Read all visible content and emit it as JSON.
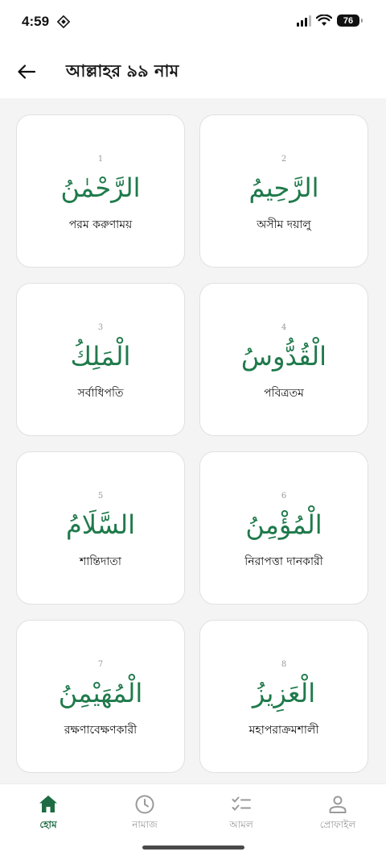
{
  "status_bar": {
    "time": "4:59",
    "battery": "76"
  },
  "header": {
    "title": "আল্লাহর ৯৯ নাম"
  },
  "names": [
    {
      "number": "1",
      "arabic": "الرَّحْمٰنُ",
      "meaning": "পরম করুণাময়"
    },
    {
      "number": "2",
      "arabic": "الرَّحِيمُ",
      "meaning": "অসীম দয়ালু"
    },
    {
      "number": "3",
      "arabic": "الْمَلِكُ",
      "meaning": "সর্বাধিপতি"
    },
    {
      "number": "4",
      "arabic": "الْقُدُّوسُ",
      "meaning": "পবিত্রতম"
    },
    {
      "number": "5",
      "arabic": "السَّلَامُ",
      "meaning": "শান্তিদাতা"
    },
    {
      "number": "6",
      "arabic": "الْمُؤْمِنُ",
      "meaning": "নিরাপত্তা দানকারী"
    },
    {
      "number": "7",
      "arabic": "الْمُهَيْمِنُ",
      "meaning": "রক্ষণাবেক্ষণকারী"
    },
    {
      "number": "8",
      "arabic": "الْعَزِيزُ",
      "meaning": "মহাপরাক্রমশালী"
    }
  ],
  "bottom_nav": [
    {
      "label": "হোম",
      "icon": "home-icon",
      "active": true
    },
    {
      "label": "নামাজ",
      "icon": "clock-icon",
      "active": false
    },
    {
      "label": "আমল",
      "icon": "checklist-icon",
      "active": false
    },
    {
      "label": "প্রোফাইল",
      "icon": "profile-icon",
      "active": false
    }
  ],
  "colors": {
    "accent": "#1f7a4b",
    "nav_active": "#1f6b43",
    "background": "#f3f4f3"
  }
}
